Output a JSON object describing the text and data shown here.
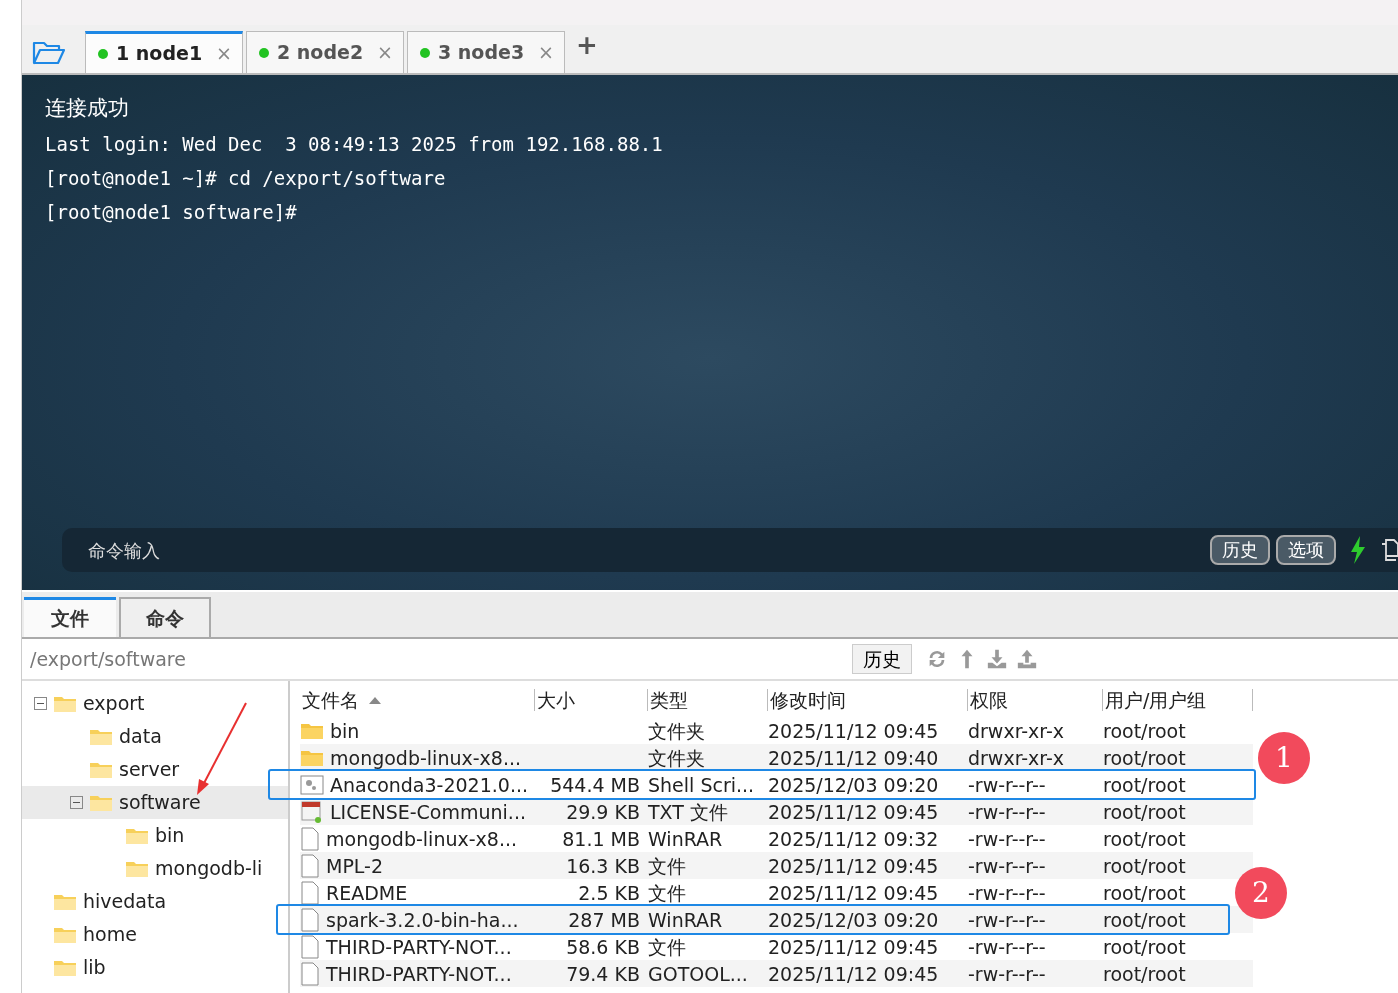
{
  "session_tabs": [
    {
      "label": "1 node1",
      "selected": true,
      "connected": true,
      "close": "×"
    },
    {
      "label": "2 node2",
      "selected": false,
      "connected": true,
      "close": "×"
    },
    {
      "label": "3 node3",
      "selected": false,
      "connected": true,
      "close": "×"
    }
  ],
  "add_tab": "+",
  "terminal": {
    "banner": "连接成功",
    "lines": [
      "Last login: Wed Dec  3 08:49:13 2025 from 192.168.88.1",
      "[root@node1 ~]# cd /export/software",
      "[root@node1 software]#"
    ],
    "command_placeholder": "命令输入",
    "buttons": [
      "历史",
      "选项"
    ]
  },
  "panel_tabs": [
    {
      "label": "文件",
      "selected": true
    },
    {
      "label": "命令",
      "selected": false
    }
  ],
  "path": "/export/software",
  "history_button": "历史",
  "tree": [
    {
      "label": "export",
      "expanded": true,
      "selected": false,
      "children": [
        {
          "label": "data",
          "selected": false
        },
        {
          "label": "server",
          "selected": false
        },
        {
          "label": "software",
          "expanded": true,
          "selected": true,
          "children": [
            {
              "label": "bin",
              "selected": false
            },
            {
              "label": "mongodb-li",
              "selected": false
            }
          ]
        }
      ]
    },
    {
      "label": "hivedata",
      "selected": false
    },
    {
      "label": "home",
      "selected": false
    },
    {
      "label": "lib",
      "selected": false
    }
  ],
  "table": {
    "columns": [
      "文件名",
      "大小",
      "类型",
      "修改时间",
      "权限",
      "用户/用户组"
    ],
    "rows": [
      {
        "kind": "folder",
        "highlighted": false,
        "cells": [
          "bin",
          "",
          "文件夹",
          "2025/11/12 09:45",
          "drwxr-xr-x",
          "root/root"
        ]
      },
      {
        "kind": "folder",
        "highlighted": false,
        "cells": [
          "mongodb-linux-x8...",
          "",
          "文件夹",
          "2025/11/12 09:40",
          "drwxr-xr-x",
          "root/root"
        ],
        "callout": "1"
      },
      {
        "kind": "script",
        "highlighted": true,
        "cells": [
          "Anaconda3-2021.0...",
          "544.4 MB",
          "Shell Scri...",
          "2025/12/03 09:20",
          "-rw-r--r--",
          "root/root"
        ]
      },
      {
        "kind": "text",
        "highlighted": false,
        "cells": [
          "LICENSE-Communi...",
          "29.9 KB",
          "TXT 文件",
          "2025/11/12 09:45",
          "-rw-r--r--",
          "root/root"
        ]
      },
      {
        "kind": "file",
        "highlighted": false,
        "cells": [
          "mongodb-linux-x8...",
          "81.1 MB",
          "WinRAR",
          "2025/11/12 09:32",
          "-rw-r--r--",
          "root/root"
        ]
      },
      {
        "kind": "file",
        "highlighted": false,
        "cells": [
          "MPL-2",
          "16.3 KB",
          "文件",
          "2025/11/12 09:45",
          "-rw-r--r--",
          "root/root"
        ]
      },
      {
        "kind": "file",
        "highlighted": false,
        "cells": [
          "README",
          "2.5 KB",
          "文件",
          "2025/11/12 09:45",
          "-rw-r--r--",
          "root/root"
        ],
        "callout": "2"
      },
      {
        "kind": "file",
        "highlighted": true,
        "cells": [
          "spark-3.2.0-bin-ha...",
          "287 MB",
          "WinRAR",
          "2025/12/03 09:20",
          "-rw-r--r--",
          "root/root"
        ]
      },
      {
        "kind": "file",
        "highlighted": false,
        "cells": [
          "THIRD-PARTY-NOT...",
          "58.6 KB",
          "文件",
          "2025/11/12 09:45",
          "-rw-r--r--",
          "root/root"
        ]
      },
      {
        "kind": "file",
        "highlighted": false,
        "cells": [
          "THIRD-PARTY-NOT...",
          "79.4 KB",
          "GOTOOL...",
          "2025/11/12 09:45",
          "-rw-r--r--",
          "root/root"
        ]
      }
    ]
  }
}
